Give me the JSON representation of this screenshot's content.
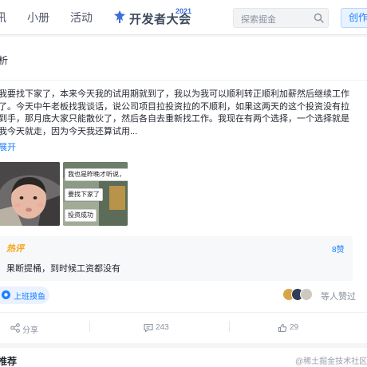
{
  "nav": {
    "items": [
      "讯",
      "小册",
      "活动"
    ],
    "conference": {
      "title": "开发者大会",
      "year": "2021"
    }
  },
  "search": {
    "placeholder": "探索掘金"
  },
  "create_button": "创作",
  "page_header": {
    "title": "析"
  },
  "post": {
    "content": "我要找下家了，本来今天我的试用期就到了，我以为我可以顺利转正顺利加薪然后继续工作了。今天中午老板找我谈话，说公司项目拉投资拉的不顺利，如果这两天的这个投资没有拉到手，那月底大家只能散伙了，然后各自去重新找工作。我现在有两个选择，一个选择就是我今天就走，因为今天我还算试用...",
    "expand_label": "展开",
    "meme_bubbles": [
      "我也是昨晚才听说，",
      "要找下家了",
      "投资成功"
    ],
    "hot_comment": {
      "tag": "热评",
      "likes": "8赞",
      "text": "果断提桶，到时候工资都没有"
    },
    "circle_tag": "上班摸鱼",
    "likers_text": "等人赞过",
    "actions": {
      "share": "分享",
      "comments": "243",
      "likes": "29"
    }
  },
  "next_post": {
    "title": "推荐"
  },
  "watermark": "@稀土掘金技术社区",
  "colors": {
    "accent": "#1e80ff",
    "hot": "#f4a51c",
    "muted": "#8a919f"
  }
}
